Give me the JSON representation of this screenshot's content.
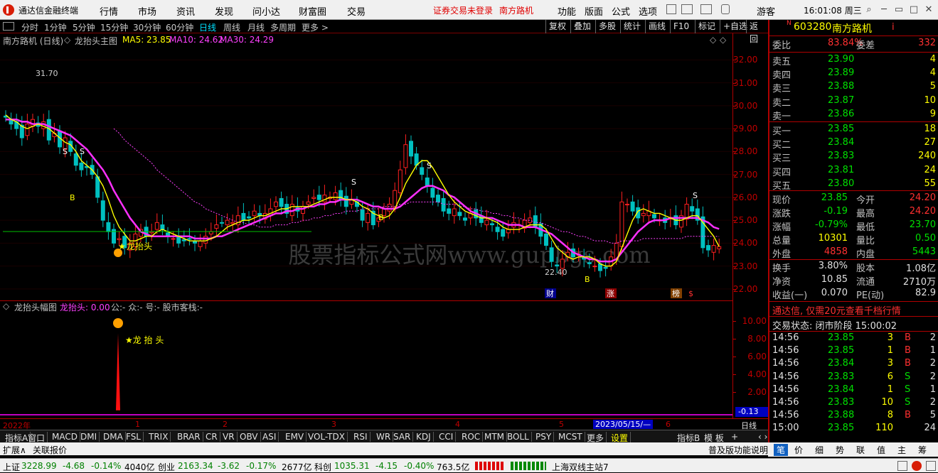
{
  "menubar": {
    "app_name": "通达信金融终端",
    "items": [
      "行情",
      "市场",
      "资讯",
      "发现",
      "问小达",
      "财富圈",
      "交易"
    ],
    "alert": "证券交易未登录",
    "stock": "南方路机",
    "right_items": [
      "功能",
      "版面",
      "公式",
      "选项"
    ],
    "user": "游客",
    "clock": "16:01:08 周三"
  },
  "toolbar": {
    "periods": [
      "分时",
      "1分钟",
      "5分钟",
      "15分钟",
      "30分钟",
      "60分钟",
      "日线",
      "周线",
      "月线",
      "多周期",
      "更多 >"
    ],
    "selected": "日线",
    "right": [
      "复权",
      "叠加",
      "多股",
      "统计",
      "画线",
      "F10",
      "标记",
      "+自选",
      "返回"
    ]
  },
  "main_header": {
    "title": "南方路机 (日线)",
    "indicator": "龙抬头主图",
    "ma5": "MA5: 23.85",
    "ma10": "MA10: 24.62",
    "ma30": "MA30: 24.29"
  },
  "chart_data": {
    "type": "candlestick",
    "period": "日线",
    "yaxis": [
      "32.00",
      "31.00",
      "30.00",
      "29.00",
      "28.00",
      "27.00",
      "26.00",
      "25.00",
      "24.00",
      "23.00",
      "22.00"
    ],
    "ylim": [
      21.5,
      32.6
    ],
    "high_label": "31.70",
    "low_label": "22.40",
    "signal_label": "龙抬头",
    "s_labels": [
      "S",
      "S",
      "S",
      "S",
      "S"
    ],
    "b_labels": [
      "B",
      "B",
      "B"
    ],
    "event_tags": [
      "财",
      "涨",
      "榜",
      "$"
    ],
    "watermark": "股票指标公式网www.gupbgs.com",
    "close": [
      29.5,
      29.2,
      29.0,
      28.6,
      29.2,
      29.4,
      29.1,
      29.3,
      28.5,
      28.8,
      28.2,
      28.6,
      28.0,
      27.4,
      27.2,
      27.3,
      27.0,
      26.0,
      25.0,
      24.5,
      24.0,
      24.2,
      23.8,
      24.0,
      24.4,
      24.6,
      24.3,
      24.5,
      24.9,
      24.6,
      24.3,
      24.2,
      24.0,
      24.1,
      24.2,
      24.0,
      24.1,
      24.3,
      24.5,
      24.8,
      24.9,
      25.0,
      24.9,
      25.2,
      25.0,
      25.1,
      25.4,
      25.2,
      25.3,
      25.5,
      25.8,
      25.6,
      25.3,
      25.7,
      25.4,
      25.6,
      25.8,
      26.0,
      25.9,
      26.1,
      26.0,
      26.2,
      25.9,
      25.6,
      25.9,
      25.6,
      25.0,
      25.3,
      24.8,
      25.1,
      25.5,
      25.7,
      26.3,
      27.2,
      28.3,
      27.8,
      27.4,
      27.0,
      26.5,
      26.0,
      25.8,
      25.4,
      25.3,
      25.5,
      25.2,
      25.0,
      25.3,
      25.1,
      24.9,
      25.0,
      24.8,
      24.5,
      24.3,
      24.6,
      24.9,
      24.8,
      25.0,
      25.1,
      24.7,
      24.3,
      23.9,
      23.2,
      23.0,
      23.3,
      23.6,
      23.4,
      23.5,
      23.3,
      23.1,
      23.0,
      22.8,
      22.9,
      23.4,
      24.0,
      25.8,
      25.7,
      25.4,
      25.1,
      25.3,
      25.4,
      25.1,
      25.0,
      24.9,
      25.1,
      24.8,
      25.2,
      25.7,
      25.4,
      25.0,
      23.8,
      23.7,
      23.9,
      23.85
    ],
    "ma5": [
      29.6,
      29.4,
      29.3,
      29.1,
      29.0,
      29.1,
      29.2,
      29.1,
      29.0,
      28.8,
      28.6,
      28.4,
      28.3,
      28.0,
      27.6,
      27.4,
      27.2,
      26.9,
      26.5,
      25.9,
      25.2,
      24.7,
      24.4,
      24.1,
      24.1,
      24.2,
      24.3,
      24.3,
      24.5,
      24.6,
      24.5,
      24.4,
      24.3,
      24.2,
      24.1,
      24.1,
      24.1,
      24.1,
      24.2,
      24.3,
      24.5,
      24.7,
      24.8,
      24.9,
      25.0,
      25.0,
      25.1,
      25.2,
      25.2,
      25.3,
      25.4,
      25.5,
      25.5,
      25.6,
      25.6,
      25.6,
      25.6,
      25.7,
      25.8,
      25.9,
      26.0,
      26.0,
      26.0,
      25.9,
      25.9,
      25.8,
      25.6,
      25.5,
      25.3,
      25.2,
      25.1,
      25.2,
      25.5,
      26.0,
      26.6,
      27.0,
      27.4,
      27.6,
      27.6,
      27.3,
      26.9,
      26.5,
      26.1,
      25.8,
      25.6,
      25.4,
      25.3,
      25.2,
      25.1,
      25.1,
      25.0,
      24.9,
      24.7,
      24.6,
      24.6,
      24.6,
      24.7,
      24.8,
      24.8,
      24.8,
      24.6,
      24.2,
      23.8,
      23.6,
      23.4,
      23.3,
      23.4,
      23.4,
      23.4,
      23.3,
      23.1,
      23.0,
      23.0,
      23.2,
      23.8,
      24.4,
      25.0,
      25.4,
      25.5,
      25.4,
      25.3,
      25.3,
      25.2,
      25.1,
      25.0,
      25.0,
      25.1,
      25.2,
      25.2,
      24.9,
      24.6,
      24.3,
      23.85
    ],
    "ma10": [
      29.4,
      29.4,
      29.4,
      29.3,
      29.3,
      29.2,
      29.2,
      29.2,
      29.1,
      29.0,
      28.9,
      28.8,
      28.7,
      28.5,
      28.3,
      28.1,
      27.8,
      27.5,
      27.2,
      26.8,
      26.3,
      25.9,
      25.5,
      25.1,
      24.8,
      24.5,
      24.4,
      24.3,
      24.3,
      24.3,
      24.3,
      24.3,
      24.3,
      24.3,
      24.3,
      24.2,
      24.2,
      24.2,
      24.2,
      24.3,
      24.3,
      24.4,
      24.5,
      24.6,
      24.7,
      24.8,
      24.9,
      25.0,
      25.1,
      25.2,
      25.3,
      25.3,
      25.4,
      25.4,
      25.5,
      25.5,
      25.6,
      25.6,
      25.7,
      25.7,
      25.8,
      25.8,
      25.9,
      25.9,
      25.9,
      25.9,
      25.8,
      25.7,
      25.6,
      25.6,
      25.5,
      25.5,
      25.5,
      25.6,
      25.8,
      26.0,
      26.2,
      26.4,
      26.5,
      26.5,
      26.4,
      26.3,
      26.1,
      26.0,
      25.8,
      25.6,
      25.4,
      25.3,
      25.2,
      25.1,
      25.1,
      25.0,
      24.9,
      24.8,
      24.8,
      24.8,
      24.7,
      24.7,
      24.7,
      24.6,
      24.5,
      24.4,
      24.2,
      24.0,
      23.8,
      23.6,
      23.5,
      23.4,
      23.3,
      23.3,
      23.2,
      23.2,
      23.2,
      23.3,
      23.6,
      23.9,
      24.2,
      24.5,
      24.7,
      24.9,
      25.0,
      25.0,
      25.0,
      25.1,
      25.1,
      25.1,
      25.1,
      25.1,
      25.1,
      25.0,
      24.9,
      24.7,
      24.62
    ],
    "ma30": [
      null,
      null,
      null,
      null,
      null,
      null,
      null,
      null,
      null,
      null,
      null,
      null,
      null,
      null,
      null,
      null,
      null,
      null,
      null,
      null,
      29.0,
      28.8,
      28.5,
      28.3,
      28.1,
      27.9,
      27.7,
      27.5,
      27.2,
      27.0,
      26.8,
      26.6,
      26.4,
      26.2,
      26.0,
      25.8,
      25.7,
      25.5,
      25.4,
      25.3,
      25.2,
      25.1,
      25.0,
      24.9,
      24.9,
      24.8,
      24.8,
      24.7,
      24.7,
      24.7,
      24.8,
      24.8,
      24.8,
      24.9,
      24.9,
      25.0,
      25.0,
      25.1,
      25.1,
      25.2,
      25.2,
      25.3,
      25.3,
      25.4,
      25.4,
      25.4,
      25.5,
      25.5,
      25.5,
      25.5,
      25.6,
      25.6,
      25.6,
      25.7,
      25.7,
      25.8,
      25.8,
      25.8,
      25.8,
      25.8,
      25.8,
      25.7,
      25.7,
      25.7,
      25.6,
      25.6,
      25.5,
      25.5,
      25.4,
      25.4,
      25.3,
      25.3,
      25.2,
      25.2,
      25.1,
      25.1,
      25.0,
      25.0,
      24.9,
      24.9,
      24.8,
      24.7,
      24.6,
      24.5,
      24.5,
      24.4,
      24.3,
      24.3,
      24.2,
      24.1,
      24.1,
      24.1,
      24.0,
      24.0,
      24.1,
      24.1,
      24.1,
      24.1,
      24.2,
      24.2,
      24.2,
      24.2,
      24.2,
      24.2,
      24.2,
      24.2,
      24.3,
      24.3,
      24.3,
      24.3,
      24.3,
      24.3,
      24.29
    ]
  },
  "sub_header": {
    "title": "龙抬头幅图",
    "value": "龙抬头: 0.00",
    "extra": "公:- 众:- 号:- 股市客栈:-"
  },
  "sub_chart": {
    "yaxis": [
      "10.00",
      "8.00",
      "6.00",
      "4.00",
      "2.00"
    ],
    "label": "★龙 抬 头",
    "peak": 8.6,
    "current": "-0.13"
  },
  "xaxis": {
    "labels": [
      "2022年",
      "1",
      "2",
      "3",
      "4",
      "5",
      "6"
    ],
    "date_box": "2023/05/15/—",
    "period": "日线"
  },
  "indicator_tabs": [
    "指标A",
    "窗口",
    "MACD",
    "DMI",
    "DMA",
    "FSL",
    "TRIX",
    "BRAR",
    "CR",
    "VR",
    "OBV",
    "ASI",
    "EMV",
    "VOL-TDX",
    "RSI",
    "WR",
    "SAR",
    "KDJ",
    "CCI",
    "ROC",
    "MTM",
    "BOLL",
    "PSY",
    "MCST",
    "更多",
    "设置"
  ],
  "tabs_right": [
    "指标B",
    "模 板",
    "+",
    "‹ ›"
  ],
  "expand": [
    "扩展∧",
    "关联报价"
  ],
  "expand_right": "普及版功能说明",
  "status": {
    "sh_label": "上证",
    "sh_val": "3228.99",
    "sh_chg": "-4.68",
    "sh_pct": "-0.14%",
    "sh_amt": "4040亿",
    "cy_label": "创业",
    "cy_val": "2163.34",
    "cy_chg": "-3.62",
    "cy_pct": "-0.17%",
    "cy_amt": "2677亿",
    "kc_label": "科创",
    "kc_val": "1035.31",
    "kc_chg": "-4.15",
    "kc_pct": "-0.40%",
    "kc_amt": "763.5亿",
    "server": "上海双线主站7"
  },
  "quote": {
    "n_tag": "N",
    "code": "603280",
    "name": "南方路机",
    "info_icon": "i",
    "weibi_label": "委比",
    "weibi": "83.84%",
    "weicha_label": "委差",
    "weicha": "332",
    "asks": [
      {
        "label": "卖五",
        "price": "23.90",
        "vol": "4"
      },
      {
        "label": "卖四",
        "price": "23.89",
        "vol": "4"
      },
      {
        "label": "卖三",
        "price": "23.88",
        "vol": "5"
      },
      {
        "label": "卖二",
        "price": "23.87",
        "vol": "10"
      },
      {
        "label": "卖一",
        "price": "23.86",
        "vol": "9"
      }
    ],
    "bids": [
      {
        "label": "买一",
        "price": "23.85",
        "vol": "18"
      },
      {
        "label": "买二",
        "price": "23.84",
        "vol": "27"
      },
      {
        "label": "买三",
        "price": "23.83",
        "vol": "240"
      },
      {
        "label": "买四",
        "price": "23.81",
        "vol": "24"
      },
      {
        "label": "买五",
        "price": "23.80",
        "vol": "55"
      }
    ],
    "stats": [
      {
        "l1": "现价",
        "v1": "23.85",
        "c1": "g",
        "l2": "今开",
        "v2": "24.20",
        "c2": "r"
      },
      {
        "l1": "涨跌",
        "v1": "-0.19",
        "c1": "g",
        "l2": "最高",
        "v2": "24.20",
        "c2": "r"
      },
      {
        "l1": "涨幅",
        "v1": "-0.79%",
        "c1": "g",
        "l2": "最低",
        "v2": "23.70",
        "c2": "g"
      },
      {
        "l1": "总量",
        "v1": "10301",
        "c1": "y",
        "l2": "量比",
        "v2": "0.50",
        "c2": "g"
      },
      {
        "l1": "外盘",
        "v1": "4858",
        "c1": "r",
        "l2": "内盘",
        "v2": "5443",
        "c2": "g"
      }
    ],
    "stats2": [
      {
        "l1": "换手",
        "v1": "3.80%",
        "l2": "股本",
        "v2": "1.08亿"
      },
      {
        "l1": "净资",
        "v1": "10.85",
        "l2": "流通",
        "v2": "2710万"
      },
      {
        "l1": "收益(一)",
        "v1": "0.070",
        "l2": "PE(动)",
        "v2": "82.9"
      }
    ],
    "banner": "通达信, 仅需20元查看千档行情",
    "trade_state": "交易状态: 闭市阶段 15:00:02",
    "ticks": [
      {
        "t": "14:56",
        "p": "23.85",
        "v": "3",
        "bs": "B",
        "n": "2"
      },
      {
        "t": "14:56",
        "p": "23.85",
        "v": "1",
        "bs": "B",
        "n": "1"
      },
      {
        "t": "14:56",
        "p": "23.84",
        "v": "3",
        "bs": "B",
        "n": "2"
      },
      {
        "t": "14:56",
        "p": "23.83",
        "v": "6",
        "bs": "S",
        "n": "2"
      },
      {
        "t": "14:56",
        "p": "23.84",
        "v": "1",
        "bs": "S",
        "n": "1"
      },
      {
        "t": "14:56",
        "p": "23.83",
        "v": "10",
        "bs": "S",
        "n": "2"
      },
      {
        "t": "14:56",
        "p": "23.88",
        "v": "8",
        "bs": "B",
        "n": "5"
      },
      {
        "t": "15:00",
        "p": "23.85",
        "v": "110",
        "bs": "",
        "n": "24"
      }
    ],
    "bottom_tabs": [
      "笔",
      "价",
      "细",
      "势",
      "联",
      "值",
      "主",
      "筹"
    ]
  }
}
